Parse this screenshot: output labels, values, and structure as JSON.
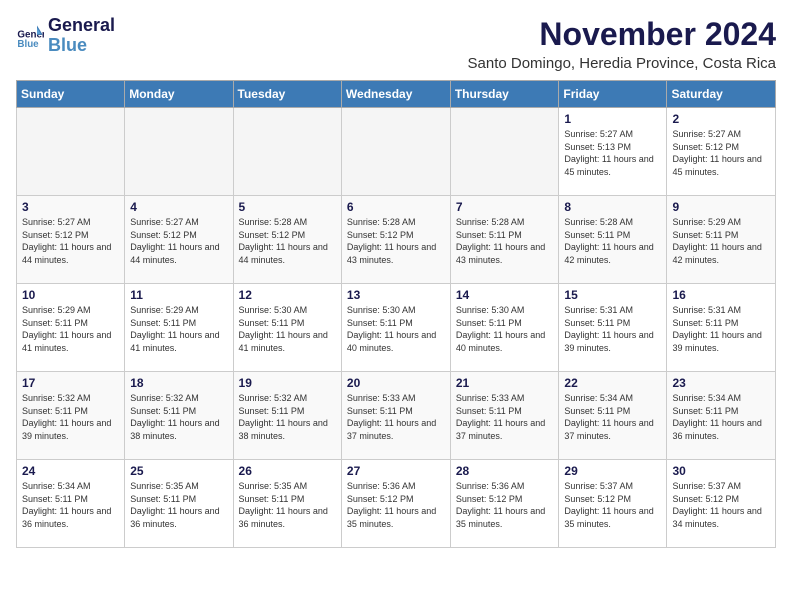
{
  "logo": {
    "line1": "General",
    "line2": "Blue"
  },
  "title": "November 2024",
  "subtitle": "Santo Domingo, Heredia Province, Costa Rica",
  "headers": [
    "Sunday",
    "Monday",
    "Tuesday",
    "Wednesday",
    "Thursday",
    "Friday",
    "Saturday"
  ],
  "weeks": [
    [
      {
        "day": "",
        "info": ""
      },
      {
        "day": "",
        "info": ""
      },
      {
        "day": "",
        "info": ""
      },
      {
        "day": "",
        "info": ""
      },
      {
        "day": "",
        "info": ""
      },
      {
        "day": "1",
        "info": "Sunrise: 5:27 AM\nSunset: 5:13 PM\nDaylight: 11 hours and 45 minutes."
      },
      {
        "day": "2",
        "info": "Sunrise: 5:27 AM\nSunset: 5:12 PM\nDaylight: 11 hours and 45 minutes."
      }
    ],
    [
      {
        "day": "3",
        "info": "Sunrise: 5:27 AM\nSunset: 5:12 PM\nDaylight: 11 hours and 44 minutes."
      },
      {
        "day": "4",
        "info": "Sunrise: 5:27 AM\nSunset: 5:12 PM\nDaylight: 11 hours and 44 minutes."
      },
      {
        "day": "5",
        "info": "Sunrise: 5:28 AM\nSunset: 5:12 PM\nDaylight: 11 hours and 44 minutes."
      },
      {
        "day": "6",
        "info": "Sunrise: 5:28 AM\nSunset: 5:12 PM\nDaylight: 11 hours and 43 minutes."
      },
      {
        "day": "7",
        "info": "Sunrise: 5:28 AM\nSunset: 5:11 PM\nDaylight: 11 hours and 43 minutes."
      },
      {
        "day": "8",
        "info": "Sunrise: 5:28 AM\nSunset: 5:11 PM\nDaylight: 11 hours and 42 minutes."
      },
      {
        "day": "9",
        "info": "Sunrise: 5:29 AM\nSunset: 5:11 PM\nDaylight: 11 hours and 42 minutes."
      }
    ],
    [
      {
        "day": "10",
        "info": "Sunrise: 5:29 AM\nSunset: 5:11 PM\nDaylight: 11 hours and 41 minutes."
      },
      {
        "day": "11",
        "info": "Sunrise: 5:29 AM\nSunset: 5:11 PM\nDaylight: 11 hours and 41 minutes."
      },
      {
        "day": "12",
        "info": "Sunrise: 5:30 AM\nSunset: 5:11 PM\nDaylight: 11 hours and 41 minutes."
      },
      {
        "day": "13",
        "info": "Sunrise: 5:30 AM\nSunset: 5:11 PM\nDaylight: 11 hours and 40 minutes."
      },
      {
        "day": "14",
        "info": "Sunrise: 5:30 AM\nSunset: 5:11 PM\nDaylight: 11 hours and 40 minutes."
      },
      {
        "day": "15",
        "info": "Sunrise: 5:31 AM\nSunset: 5:11 PM\nDaylight: 11 hours and 39 minutes."
      },
      {
        "day": "16",
        "info": "Sunrise: 5:31 AM\nSunset: 5:11 PM\nDaylight: 11 hours and 39 minutes."
      }
    ],
    [
      {
        "day": "17",
        "info": "Sunrise: 5:32 AM\nSunset: 5:11 PM\nDaylight: 11 hours and 39 minutes."
      },
      {
        "day": "18",
        "info": "Sunrise: 5:32 AM\nSunset: 5:11 PM\nDaylight: 11 hours and 38 minutes."
      },
      {
        "day": "19",
        "info": "Sunrise: 5:32 AM\nSunset: 5:11 PM\nDaylight: 11 hours and 38 minutes."
      },
      {
        "day": "20",
        "info": "Sunrise: 5:33 AM\nSunset: 5:11 PM\nDaylight: 11 hours and 37 minutes."
      },
      {
        "day": "21",
        "info": "Sunrise: 5:33 AM\nSunset: 5:11 PM\nDaylight: 11 hours and 37 minutes."
      },
      {
        "day": "22",
        "info": "Sunrise: 5:34 AM\nSunset: 5:11 PM\nDaylight: 11 hours and 37 minutes."
      },
      {
        "day": "23",
        "info": "Sunrise: 5:34 AM\nSunset: 5:11 PM\nDaylight: 11 hours and 36 minutes."
      }
    ],
    [
      {
        "day": "24",
        "info": "Sunrise: 5:34 AM\nSunset: 5:11 PM\nDaylight: 11 hours and 36 minutes."
      },
      {
        "day": "25",
        "info": "Sunrise: 5:35 AM\nSunset: 5:11 PM\nDaylight: 11 hours and 36 minutes."
      },
      {
        "day": "26",
        "info": "Sunrise: 5:35 AM\nSunset: 5:11 PM\nDaylight: 11 hours and 36 minutes."
      },
      {
        "day": "27",
        "info": "Sunrise: 5:36 AM\nSunset: 5:12 PM\nDaylight: 11 hours and 35 minutes."
      },
      {
        "day": "28",
        "info": "Sunrise: 5:36 AM\nSunset: 5:12 PM\nDaylight: 11 hours and 35 minutes."
      },
      {
        "day": "29",
        "info": "Sunrise: 5:37 AM\nSunset: 5:12 PM\nDaylight: 11 hours and 35 minutes."
      },
      {
        "day": "30",
        "info": "Sunrise: 5:37 AM\nSunset: 5:12 PM\nDaylight: 11 hours and 34 minutes."
      }
    ]
  ]
}
